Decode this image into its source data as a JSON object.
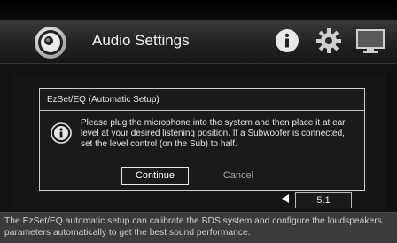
{
  "header": {
    "title": "Audio Settings",
    "app_icon": "speaker-icon",
    "icons": [
      "info-icon",
      "gear-icon",
      "tv-icon"
    ]
  },
  "background": {
    "partial_value": "5.1"
  },
  "dialog": {
    "title": "EzSet/EQ (Automatic Setup)",
    "icon": "info-icon",
    "message": "Please plug the microphone into the system and then place it at ear level at your desired listening position. If a Subwoofer is connected, set the level control (on the Sub) to half.",
    "continue_label": "Continue",
    "cancel_label": "Cancel"
  },
  "footer": {
    "text": "The EzSet/EQ automatic setup can calibrate the BDS system and configure the loudspeakers parameters automatically to get the best sound performance."
  },
  "colors": {
    "background": "#111111",
    "footer_bg": "#3b3b3b",
    "text": "#ffffff"
  }
}
